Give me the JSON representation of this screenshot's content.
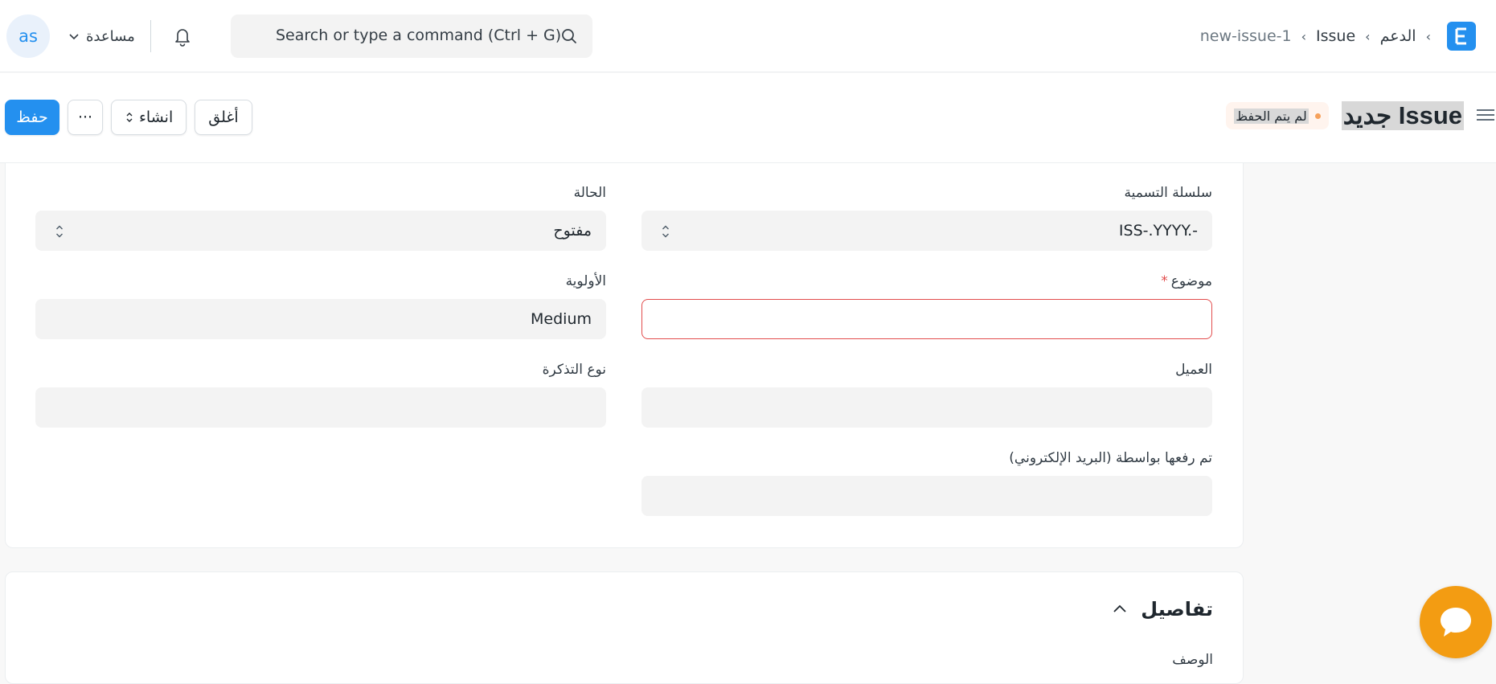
{
  "navbar": {
    "avatar_initials": "as",
    "help_label": "مساعدة",
    "search_placeholder": "Search or type a command (Ctrl + G)",
    "breadcrumb": [
      "الدعم",
      "Issue",
      "new-issue-1"
    ]
  },
  "page_head": {
    "title": "Issue جديد",
    "status": "لم يتم الحفظ",
    "buttons": {
      "save": "حفظ",
      "more": "···",
      "create": "انشاء",
      "close": "أغلق"
    }
  },
  "form": {
    "naming_series": {
      "label": "سلسلة التسمية",
      "value": "ISS-.YYYY.-"
    },
    "status": {
      "label": "الحالة",
      "value": "مفتوح"
    },
    "subject": {
      "label": "موضوع",
      "required_mark": "*",
      "value": ""
    },
    "priority": {
      "label": "الأولوية",
      "value": "Medium"
    },
    "customer": {
      "label": "العميل",
      "value": ""
    },
    "issue_type": {
      "label": "نوع التذكرة",
      "value": ""
    },
    "raised_by": {
      "label": "تم رفعها بواسطة (البريد الإلكتروني)",
      "value": ""
    }
  },
  "details_section": {
    "title": "تفاصيل",
    "description_label": "الوصف"
  },
  "colors": {
    "primary": "#2490ef",
    "required": "#e24c4c",
    "chat": "#f39c12",
    "unsaved_dot": "#f6a15b"
  }
}
